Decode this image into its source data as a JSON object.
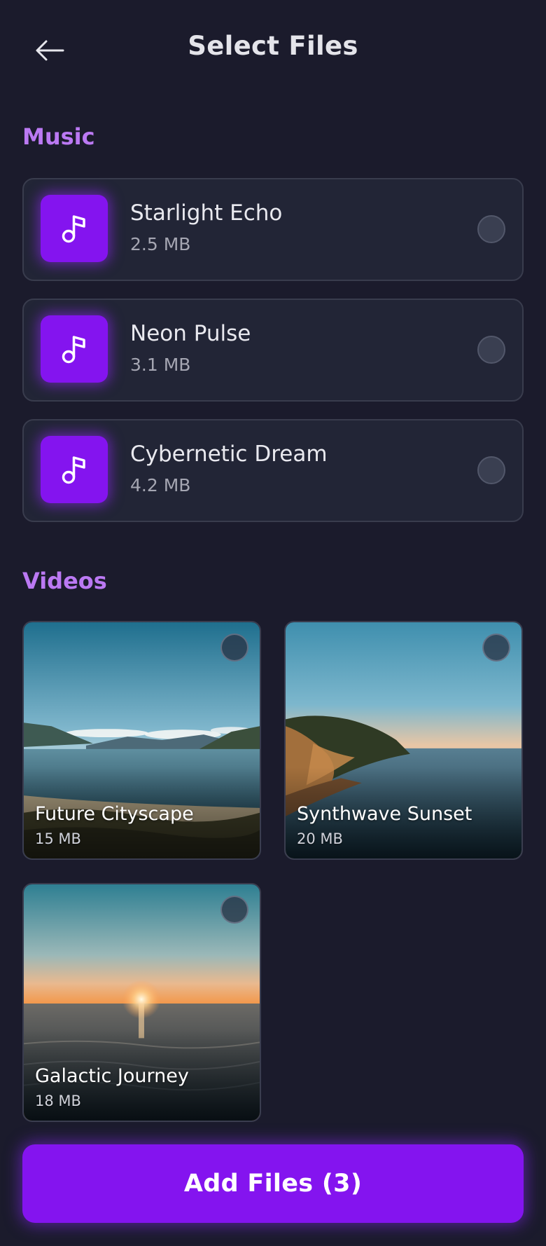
{
  "header": {
    "title": "Select Files",
    "back_icon": "arrow-left-icon"
  },
  "music": {
    "section_title": "Music",
    "items": [
      {
        "name": "Starlight Echo",
        "size": "2.5 MB",
        "icon": "music-note-icon",
        "selected": false
      },
      {
        "name": "Neon Pulse",
        "size": "3.1 MB",
        "icon": "music-note-icon",
        "selected": false
      },
      {
        "name": "Cybernetic Dream",
        "size": "4.2 MB",
        "icon": "music-note-icon",
        "selected": false
      }
    ]
  },
  "videos": {
    "section_title": "Videos",
    "items": [
      {
        "name": "Future Cityscape",
        "size": "15 MB",
        "selected": false
      },
      {
        "name": "Synthwave Sunset",
        "size": "20 MB",
        "selected": false
      },
      {
        "name": "Galactic Journey",
        "size": "18 MB",
        "selected": false
      }
    ]
  },
  "footer": {
    "add_button_label": "Add Files (3)"
  },
  "colors": {
    "background": "#1b1b2c",
    "accent": "#8414ef",
    "section_title": "#bb79f3",
    "card": "#222536"
  }
}
